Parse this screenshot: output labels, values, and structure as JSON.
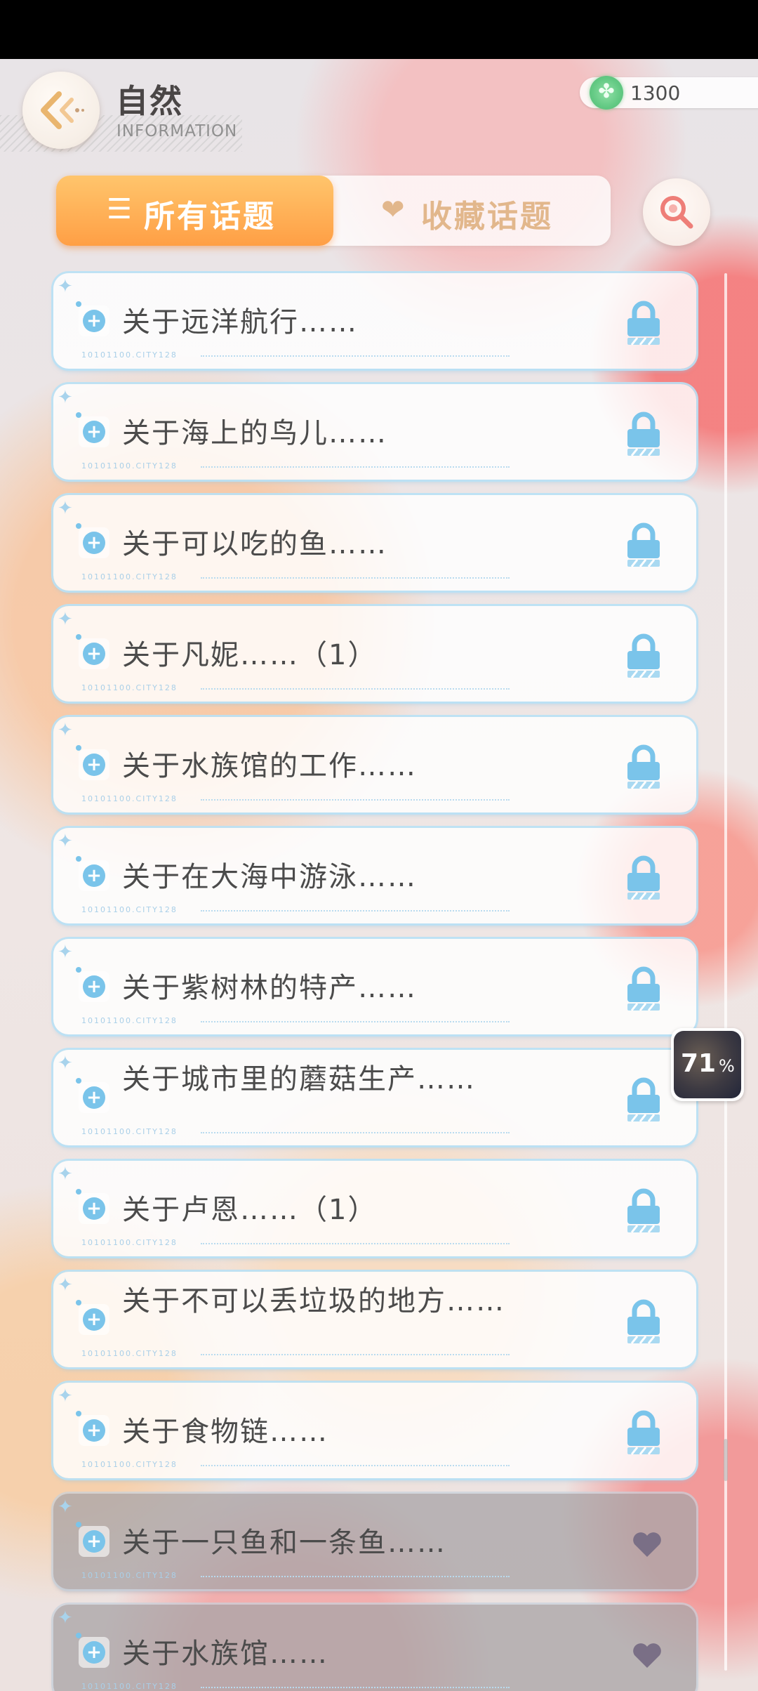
{
  "header": {
    "title": "自然",
    "subtitle": "INFORMATION"
  },
  "currency": {
    "icon": "clover-coin-icon",
    "value": "1300"
  },
  "tabs": [
    {
      "label": "所有话题",
      "icon": "list-icon",
      "active": true
    },
    {
      "label": "收藏话题",
      "icon": "heart-icon",
      "active": false
    }
  ],
  "topic_code": "10101100.CITY128",
  "topics": [
    {
      "title": "关于远洋航行……",
      "status": "locked"
    },
    {
      "title": "关于海上的鸟儿……",
      "status": "locked"
    },
    {
      "title": "关于可以吃的鱼……",
      "status": "locked"
    },
    {
      "title": "关于凡妮……（1）",
      "status": "locked"
    },
    {
      "title": "关于水族馆的工作……",
      "status": "locked"
    },
    {
      "title": "关于在大海中游泳……",
      "status": "locked"
    },
    {
      "title": "关于紫树林的特产……",
      "status": "locked"
    },
    {
      "title": "关于城市里的蘑菇生产……",
      "status": "locked"
    },
    {
      "title": "关于卢恩……（1）",
      "status": "locked"
    },
    {
      "title": "关于不可以丢垃圾的地方……",
      "status": "locked"
    },
    {
      "title": "关于食物链……",
      "status": "locked"
    },
    {
      "title": "关于一只鱼和一条鱼……",
      "status": "unlocked"
    },
    {
      "title": "关于水族馆……",
      "status": "unlocked"
    }
  ],
  "floating_widget": {
    "value": 71,
    "number": "71",
    "unit": "%"
  },
  "colors": {
    "accent_orange": "#ff9f45",
    "lock_blue": "#7ac4ea",
    "heart_purple": "#7a6f86"
  }
}
